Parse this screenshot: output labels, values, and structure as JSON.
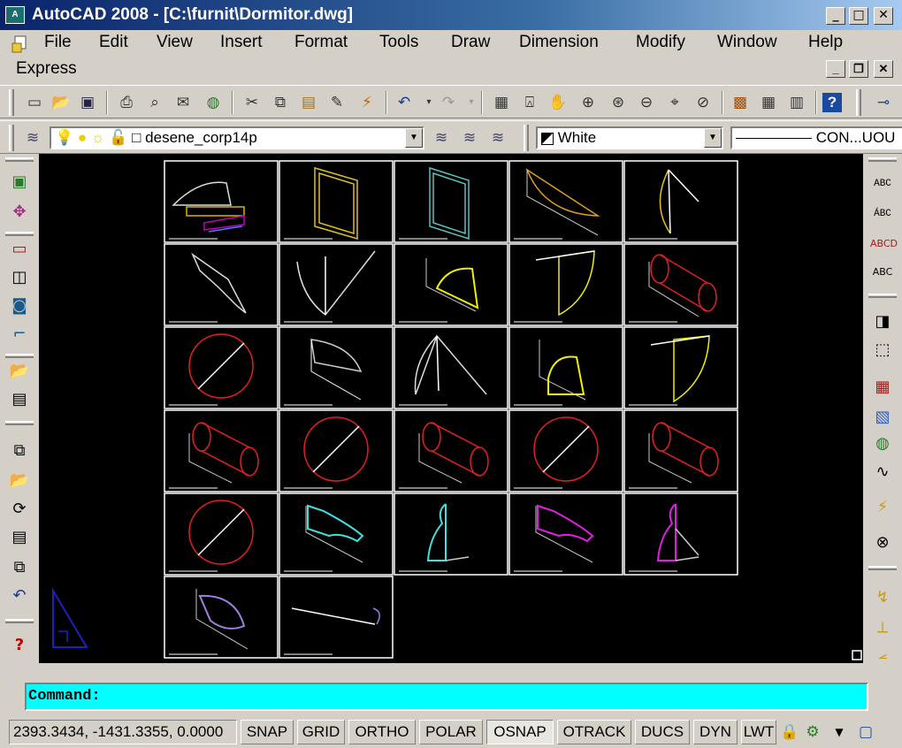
{
  "window": {
    "title": "AutoCAD 2008 - [C:\\furnit\\Dormitor.dwg]",
    "app_icon_label": "A",
    "controls": [
      "_",
      "□",
      "✕"
    ]
  },
  "menu": {
    "items": [
      "File",
      "Edit",
      "View",
      "Insert",
      "Format",
      "Tools",
      "Draw",
      "Dimension",
      "Modify",
      "Window",
      "Help"
    ],
    "second_row": [
      "Express"
    ],
    "mdi_controls": [
      "_",
      "❐",
      "✕"
    ]
  },
  "layers": {
    "current_layer": "desene_corp14p",
    "color": "White",
    "linetype": "CON...UOU"
  },
  "command": {
    "prompt": "Command:"
  },
  "status": {
    "coords": "2393.3434, -1431.3355, 0.0000",
    "toggles": [
      "SNAP",
      "GRID",
      "ORTHO",
      "POLAR",
      "OSNAP",
      "OTRACK",
      "DUCS",
      "DYN",
      "LWT"
    ],
    "active": [
      "OSNAP"
    ]
  },
  "colors": {
    "title_gradient_start": "#0a246a",
    "command_bg": "#00ffff",
    "canvas_bg": "#000000"
  },
  "icons": {
    "standard_toolbar": [
      "new-icon",
      "open-icon",
      "save-icon",
      "plot-icon",
      "preview-icon",
      "publish-icon",
      "web-icon",
      "cut-icon",
      "copy-icon",
      "paste-icon",
      "matchprop-icon",
      "blockeditor-icon",
      "undo-icon",
      "redo-icon",
      "pan-icon",
      "zoom-realtime-icon",
      "zoom-window-icon",
      "zoom-previous-icon",
      "properties-icon",
      "designcenter-icon",
      "toolpalette-icon",
      "help-icon"
    ],
    "left_toolbar": [
      "layer-icon",
      "color-icon",
      "box-icon",
      "solid-icon",
      "cylinder-icon",
      "polyline-icon",
      "open-file-icon",
      "text-icon",
      "view-icon",
      "open-file-icon",
      "orbit-icon",
      "list-icon",
      "copy-icon",
      "undo-icon",
      "help-icon"
    ],
    "right_toolbar": [
      "spell-icon",
      "text-edit-icon",
      "spellcheck-icon",
      "text-style-icon",
      "hatch-icon",
      "gradient-icon",
      "render-icon",
      "region-icon",
      "break-icon",
      "explode-icon",
      "dimension-icon",
      "measure-icon",
      "angle-icon"
    ]
  }
}
